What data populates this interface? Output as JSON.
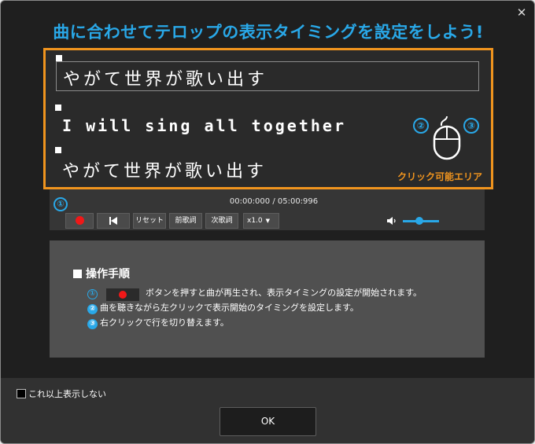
{
  "window": {
    "close_glyph": "✕"
  },
  "headline": "曲に合わせてテロップの表示タイミングを設定をしよう!",
  "preview": {
    "lines": [
      {
        "text": "やがて世界が歌い出す",
        "active": true
      },
      {
        "text": "I will sing all together",
        "active": false
      },
      {
        "text": "やがて世界が歌い出す",
        "active": false
      }
    ],
    "mouse_left_num": "②",
    "mouse_right_num": "③",
    "click_area_label": "クリック可能エリア"
  },
  "player": {
    "step_num": "①",
    "time": "00:00:000 / 05:00:996",
    "reset_label": "リセット",
    "prev_label": "前歌詞",
    "next_label": "次歌詞",
    "speed_value": "x1.0",
    "volume_fraction": 0.45,
    "icons": [
      "record-icon",
      "skip-back-icon",
      "speaker-icon"
    ],
    "accent_color": "#29a8e8",
    "record_color": "#f01818"
  },
  "instructions": {
    "title": "操作手順",
    "steps": [
      {
        "num": "①",
        "text": "ボタンを押すと曲が再生され、表示タイミングの設定が開始されます。"
      },
      {
        "num": "②",
        "text": "曲を聴きながら左クリックで表示開始のタイミングを設定します。"
      },
      {
        "num": "③",
        "text": "右クリックで行を切り替えます。"
      }
    ]
  },
  "footer": {
    "dont_show_label": "これ以上表示しない",
    "ok_label": "OK"
  },
  "colors": {
    "highlight_orange": "#f0941e",
    "accent_blue": "#29a8e8"
  }
}
